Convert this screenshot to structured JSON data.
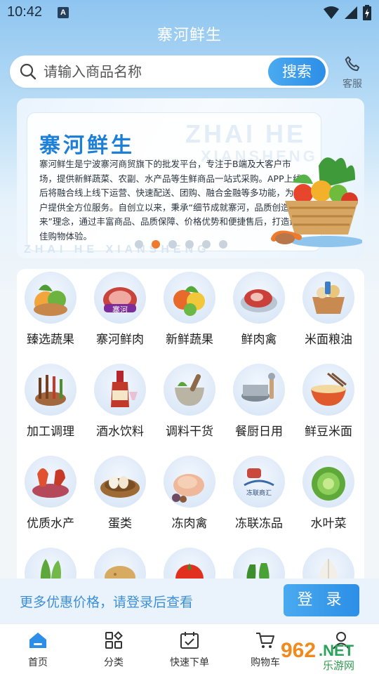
{
  "status": {
    "time": "10:42",
    "app_badge": "A"
  },
  "header": {
    "title": "寨河鲜生"
  },
  "search": {
    "placeholder": "请输入商品名称",
    "button_label": "搜索"
  },
  "service": {
    "label": "客服",
    "icon": "phone-icon"
  },
  "banner": {
    "title": "寨河鲜生",
    "watermark_line1": "ZHAI HE",
    "watermark_line2": "XIANSHENG",
    "watermark_bottom": "ZHAI HE XIANSHENG",
    "description": "寨河鲜生是宁波寨河商贸旗下的批发平台，专注于B端及大客户市场，提供新鲜蔬菜、农副、水产品等生鲜商品一站式采购。APP上线后将融合线上线下运营、快速配送、团购、融合金融等多功能，为用户提供全方位服务。自创立以来，秉承“细节成就寨河，品质创造未来”理念，通过丰富商品、品质保障、价格优势和便捷售后，打造最佳购物体验。",
    "dots": 6,
    "active_dot": 1
  },
  "categories": [
    {
      "label": "臻选蔬果",
      "icon": "fruit-veg-icon"
    },
    {
      "label": "寨河鲜肉",
      "icon": "meat-icon",
      "badge": "寨河"
    },
    {
      "label": "新鲜蔬果",
      "icon": "fresh-produce-icon"
    },
    {
      "label": "鲜肉禽",
      "icon": "steak-icon"
    },
    {
      "label": "米面粮油",
      "icon": "grain-basket-icon"
    },
    {
      "label": "加工调理",
      "icon": "skewers-icon"
    },
    {
      "label": "酒水饮料",
      "icon": "wine-icon"
    },
    {
      "label": "调料干货",
      "icon": "mortar-icon"
    },
    {
      "label": "餐厨日用",
      "icon": "cookware-icon"
    },
    {
      "label": "鲜豆米面",
      "icon": "noodle-bowl-icon"
    },
    {
      "label": "优质水产",
      "icon": "seafood-icon"
    },
    {
      "label": "蛋类",
      "icon": "egg-nest-icon"
    },
    {
      "label": "冻肉禽",
      "icon": "frozen-chicken-icon"
    },
    {
      "label": "冻联冻品",
      "icon": "frozen-brand-icon",
      "badge": "冻联商汇"
    },
    {
      "label": "水叶菜",
      "icon": "lettuce-icon"
    },
    {
      "label": "",
      "icon": "bok-choy-icon"
    },
    {
      "label": "",
      "icon": "potato-icon"
    },
    {
      "label": "",
      "icon": "tomato-icon"
    },
    {
      "label": "",
      "icon": "pepper-icon"
    },
    {
      "label": "",
      "icon": "garlic-icon"
    }
  ],
  "login": {
    "prompt": "更多优惠价格，请登录后查看",
    "button_label": "登 录"
  },
  "nav": [
    {
      "label": "首页",
      "icon": "home-icon"
    },
    {
      "label": "分类",
      "icon": "category-icon"
    },
    {
      "label": "快速下单",
      "icon": "calendar-check-icon"
    },
    {
      "label": "购物车",
      "icon": "cart-icon"
    },
    {
      "label": "",
      "icon": "user-icon"
    }
  ],
  "site_watermark": {
    "number": "962",
    "suffix": ".NET",
    "sub": "乐游网"
  },
  "colors": {
    "accent": "#2c8ee6",
    "active_dot": "#f07a2c",
    "login_text": "#3d8fd6"
  }
}
